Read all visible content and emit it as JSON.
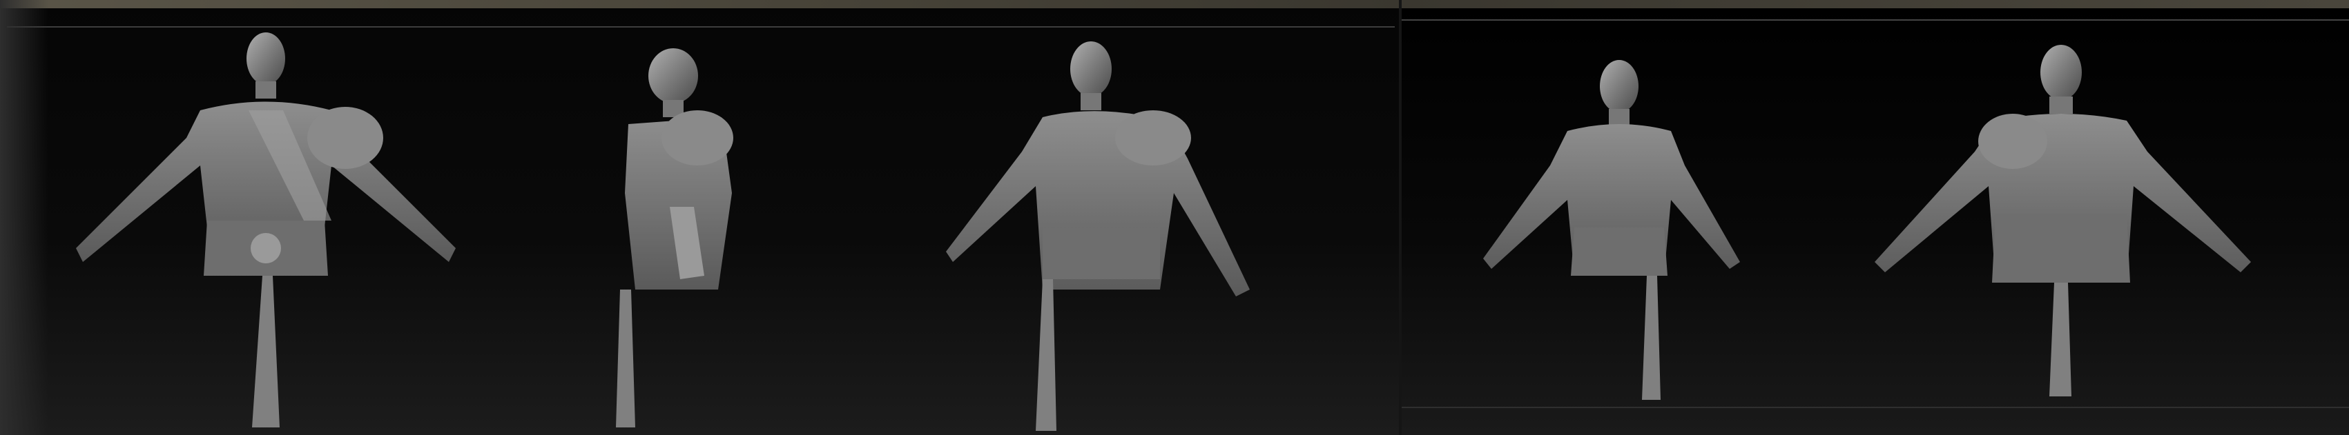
{
  "viewport": {
    "background": "#000000",
    "model_color": "#8a8a8a",
    "views": [
      {
        "id": "front",
        "orientation": "front"
      },
      {
        "id": "side-left",
        "orientation": "side"
      },
      {
        "id": "three-quarter-right",
        "orientation": "three-quarter"
      },
      {
        "id": "three-quarter-left",
        "orientation": "three-quarter"
      },
      {
        "id": "back",
        "orientation": "back"
      }
    ]
  }
}
